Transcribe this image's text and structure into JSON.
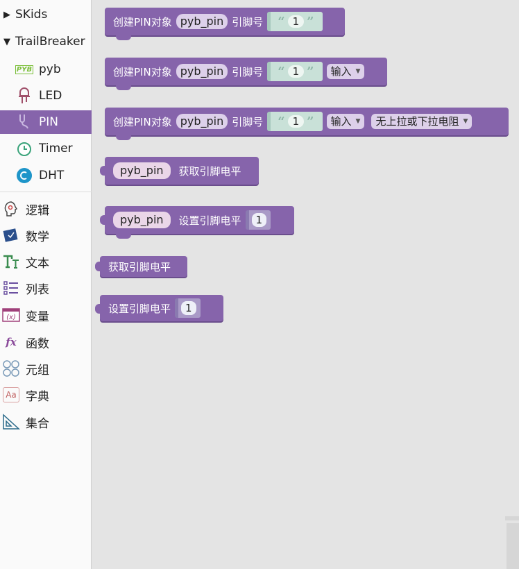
{
  "sidebar": {
    "tree": [
      {
        "label": "SKids",
        "arrow": "▶",
        "expanded": false
      },
      {
        "label": "TrailBreaker",
        "arrow": "▼",
        "expanded": true
      }
    ],
    "sub_items": [
      {
        "label": "pyb",
        "icon": "pyb-icon",
        "selected": false
      },
      {
        "label": "LED",
        "icon": "led-icon",
        "selected": false
      },
      {
        "label": "PIN",
        "icon": "pin-icon",
        "selected": true
      },
      {
        "label": "Timer",
        "icon": "timer-icon",
        "selected": false
      },
      {
        "label": "DHT",
        "icon": "dht-icon",
        "selected": false
      }
    ],
    "categories": [
      {
        "label": "逻辑",
        "icon": "logic-icon"
      },
      {
        "label": "数学",
        "icon": "math-icon"
      },
      {
        "label": "文本",
        "icon": "text-icon"
      },
      {
        "label": "列表",
        "icon": "list-icon"
      },
      {
        "label": "变量",
        "icon": "variable-icon"
      },
      {
        "label": "函数",
        "icon": "function-icon"
      },
      {
        "label": "元组",
        "icon": "tuple-icon"
      },
      {
        "label": "字典",
        "icon": "dict-icon"
      },
      {
        "label": "集合",
        "icon": "set-icon"
      }
    ],
    "pyb_icon_text": "PYB"
  },
  "blocks": {
    "create_label": "创建PIN对象",
    "pin_label": "引脚号",
    "var_name": "pyb_pin",
    "pin_value": "1",
    "mode_value": "输入",
    "pull_value": "无上拉或下拉电阻",
    "get_level_label": "获取引脚电平",
    "set_level_label": "设置引脚电平",
    "level_value": "1",
    "quote_open": "“",
    "quote_close": "”",
    "caret": "▼"
  },
  "colors": {
    "block": "#8664ab",
    "selected": "#8664ab",
    "string_socket": "#c9e1d8"
  }
}
